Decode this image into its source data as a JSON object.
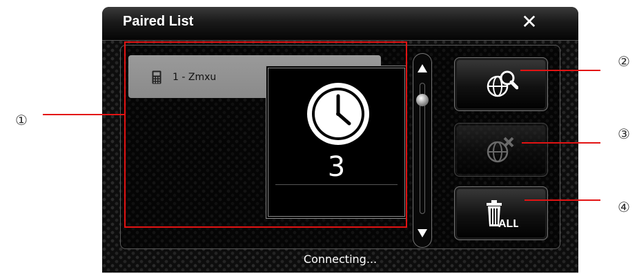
{
  "window": {
    "title": "Paired List",
    "close_glyph": "✕"
  },
  "list": {
    "items": [
      {
        "label": "1 - Zmxu",
        "icon": "phone-icon"
      }
    ]
  },
  "popup": {
    "icon": "clock-icon",
    "countdown": "3"
  },
  "buttons": [
    {
      "name": "search-device-button",
      "icon": "globe-search-icon",
      "enabled": true
    },
    {
      "name": "delete-device-button",
      "icon": "globe-delete-icon",
      "enabled": false
    },
    {
      "name": "delete-all-button",
      "icon": "trash-all-icon",
      "label": "ALL",
      "enabled": true
    }
  ],
  "status": {
    "text": "Connecting..."
  },
  "annotations": {
    "callout_1": "①",
    "callout_2": "②",
    "callout_3": "③",
    "callout_4": "④"
  },
  "colors": {
    "annotation": "#e31313",
    "background": "#0d0d0d",
    "list_item": "#9a9a9a"
  }
}
